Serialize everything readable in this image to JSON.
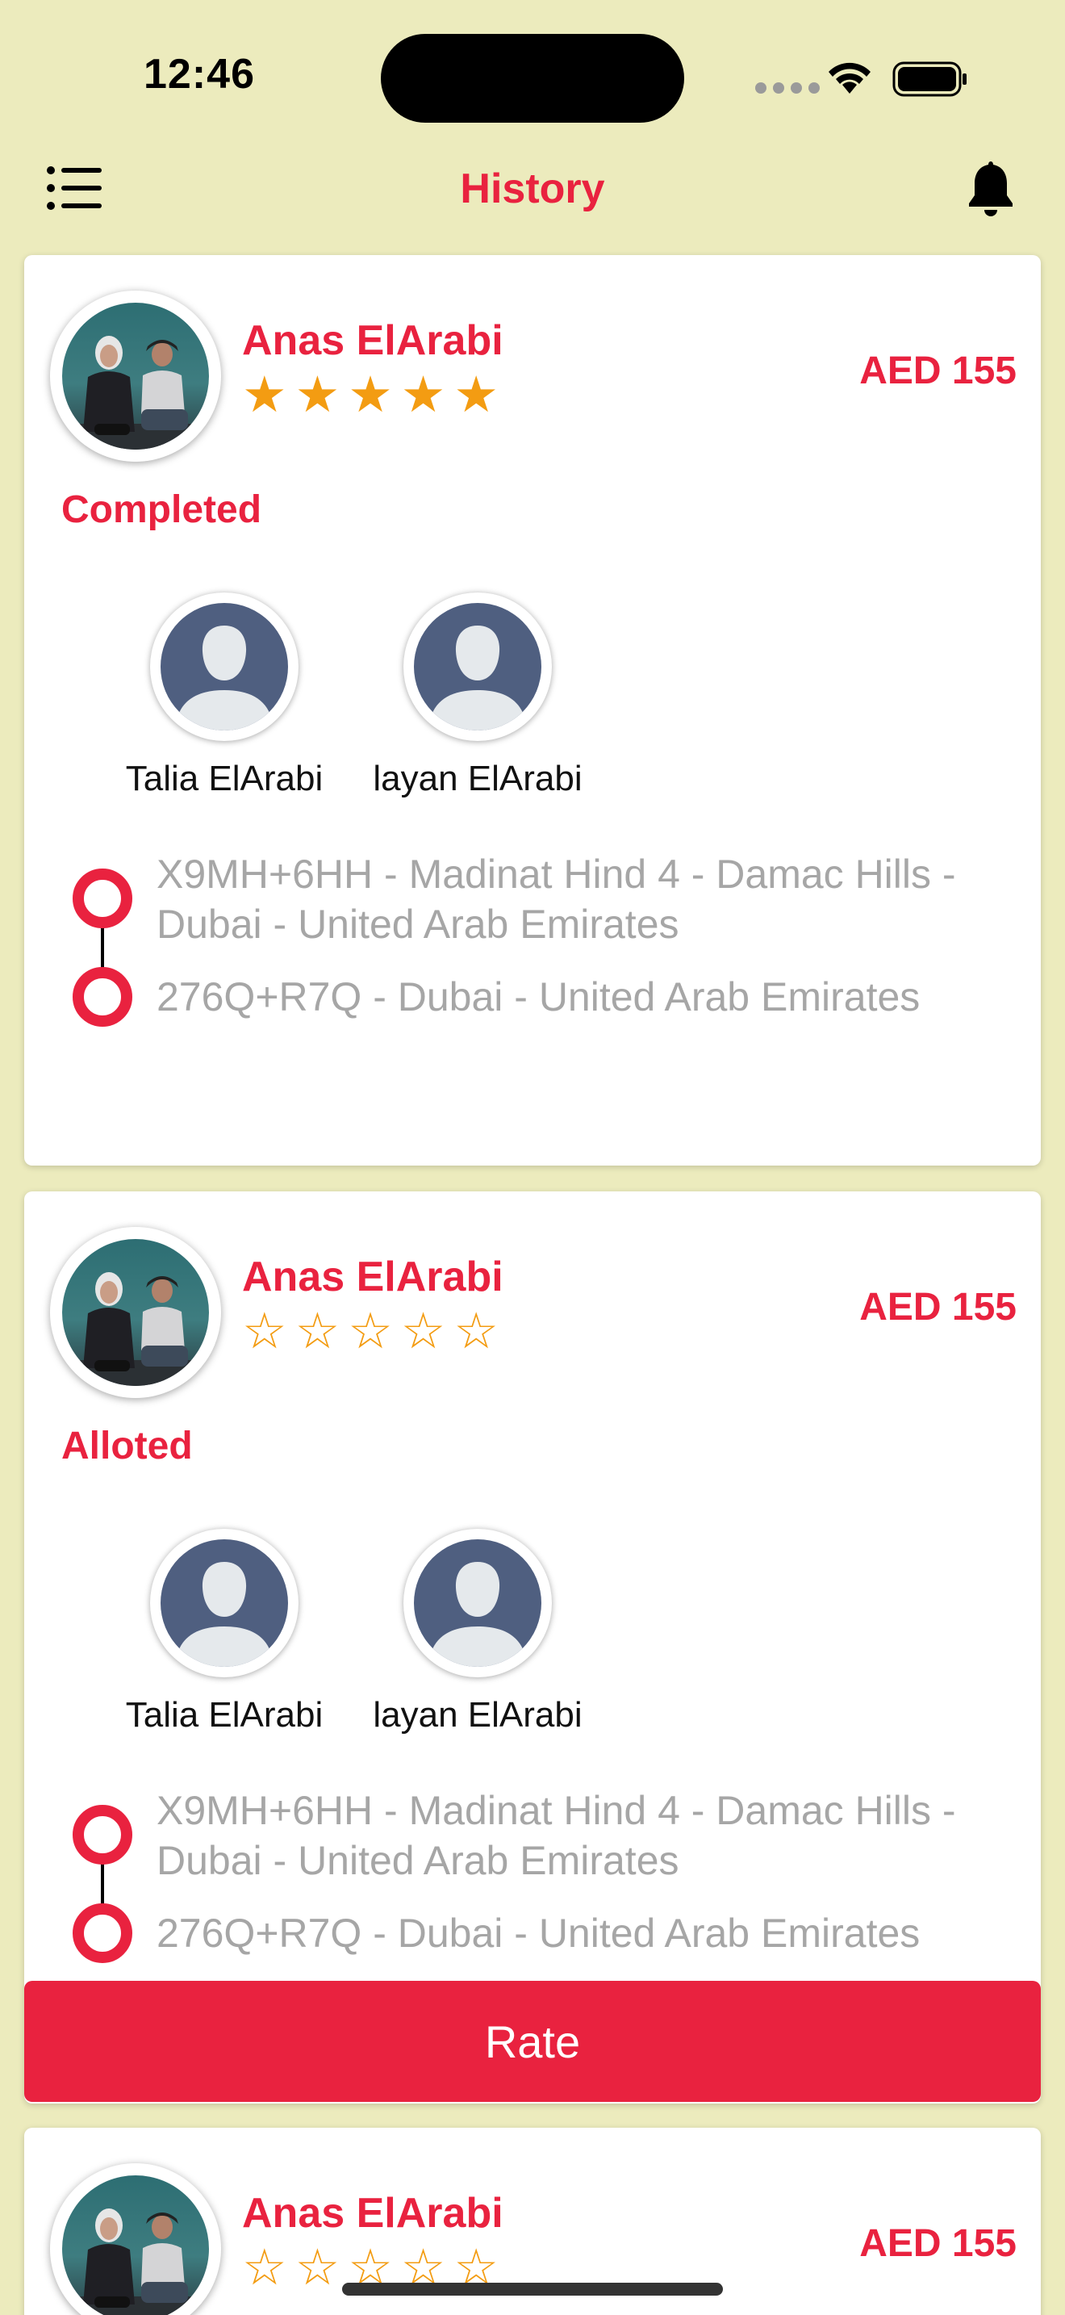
{
  "status_bar": {
    "time": "12:46"
  },
  "nav": {
    "title": "History",
    "menu_icon": "list-icon",
    "bell_icon": "bell-icon"
  },
  "colors": {
    "accent": "#e9223f",
    "background": "#ecebbd",
    "star": "#f39c12",
    "address": "#a6a6a6"
  },
  "cards": [
    {
      "driver_name": "Anas ElArabi",
      "rating": 5,
      "price": "AED 155",
      "status": "Completed",
      "children": [
        {
          "name": "Talia ElArabi"
        },
        {
          "name": "layan ElArabi"
        }
      ],
      "pickup": "X9MH+6HH - Madinat Hind 4 - Damac Hills - Dubai - United Arab Emirates",
      "dropoff": "276Q+R7Q - Dubai - United Arab Emirates"
    },
    {
      "driver_name": "Anas ElArabi",
      "rating": 0,
      "price": "AED 155",
      "status": "Alloted",
      "children": [
        {
          "name": "Talia ElArabi"
        },
        {
          "name": "layan ElArabi"
        }
      ],
      "pickup": "X9MH+6HH - Madinat Hind 4 - Damac Hills - Dubai - United Arab Emirates",
      "dropoff": "276Q+R7Q - Dubai - United Arab Emirates",
      "action_label": "Rate"
    },
    {
      "driver_name": "Anas ElArabi",
      "rating": 0,
      "price": "AED 155"
    }
  ]
}
